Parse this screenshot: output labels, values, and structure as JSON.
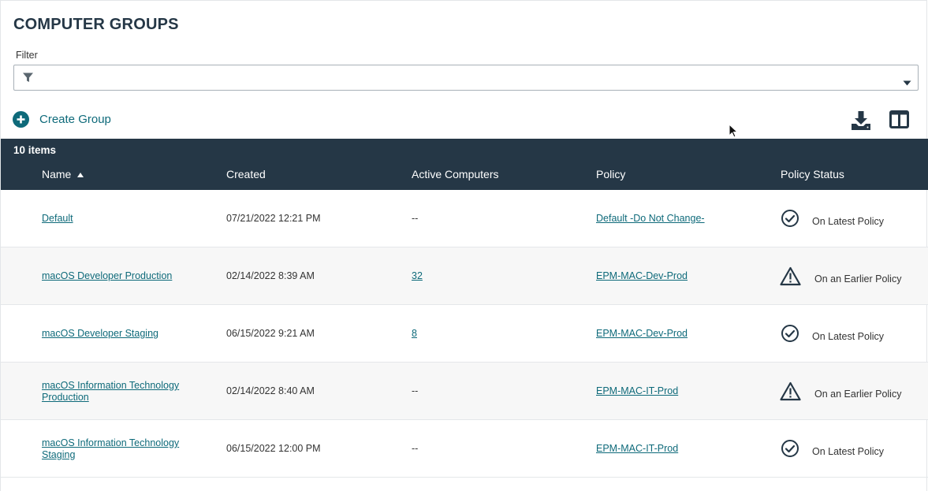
{
  "page": {
    "title": "COMPUTER GROUPS"
  },
  "filter": {
    "label": "Filter",
    "value": ""
  },
  "toolbar": {
    "create_label": "Create Group"
  },
  "table": {
    "count_label": "10 items",
    "columns": [
      "Name",
      "Created",
      "Active Computers",
      "Policy",
      "Policy Status"
    ],
    "sort": {
      "column": "Name",
      "direction": "ascending"
    },
    "rows": [
      {
        "name": "Default",
        "created": "07/21/2022 12:21 PM",
        "active": "--",
        "policy": "Default -Do Not Change-",
        "status": "On Latest Policy",
        "status_icon": "check-circle-icon"
      },
      {
        "name": "macOS Developer Production",
        "created": "02/14/2022 8:39 AM",
        "active": "32",
        "policy": "EPM-MAC-Dev-Prod",
        "status": "On an Earlier Policy",
        "status_icon": "warning-triangle-icon"
      },
      {
        "name": "macOS Developer Staging",
        "created": "06/15/2022 9:21 AM",
        "active": "8",
        "policy": "EPM-MAC-Dev-Prod",
        "status": "On Latest Policy",
        "status_icon": "check-circle-icon"
      },
      {
        "name": "macOS Information Technology Production",
        "created": "02/14/2022 8:40 AM",
        "active": "--",
        "policy": "EPM-MAC-IT-Prod",
        "status": "On an Earlier Policy",
        "status_icon": "warning-triangle-icon"
      },
      {
        "name": "macOS Information Technology Staging",
        "created": "06/15/2022 12:00 PM",
        "active": "--",
        "policy": "EPM-MAC-IT-Prod",
        "status": "On Latest Policy",
        "status_icon": "check-circle-icon"
      }
    ]
  },
  "colors": {
    "header_bg": "#253746",
    "accent": "#0e6a7a",
    "row_alt": "#f7f7f7"
  }
}
